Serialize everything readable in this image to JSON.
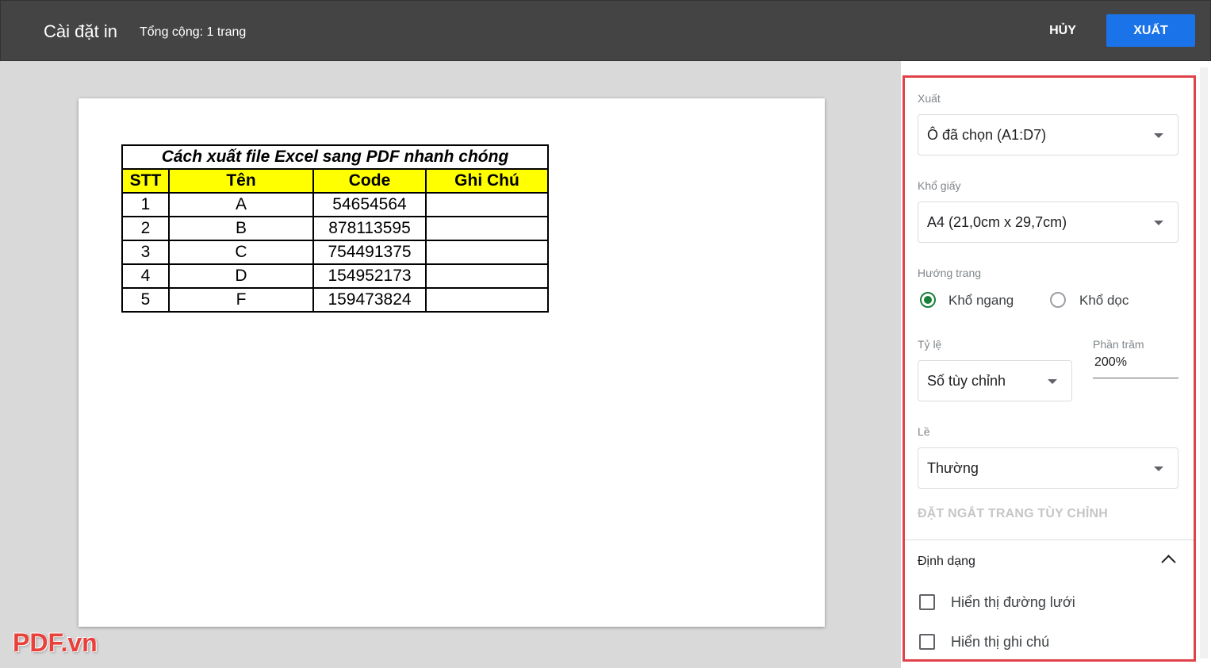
{
  "header": {
    "title": "Cài đặt in",
    "page_count": "Tổng cộng: 1 trang",
    "cancel_label": "HỦY",
    "export_label": "XUẤT"
  },
  "sheet": {
    "title": "Cách xuất file Excel sang PDF nhanh chóng",
    "columns": [
      "STT",
      "Tên",
      "Code",
      "Ghi Chú"
    ],
    "rows": [
      [
        "1",
        "A",
        "54654564",
        ""
      ],
      [
        "2",
        "B",
        "878113595",
        ""
      ],
      [
        "3",
        "C",
        "754491375",
        ""
      ],
      [
        "4",
        "D",
        "154952173",
        ""
      ],
      [
        "5",
        "F",
        "159473824",
        ""
      ]
    ],
    "header_color": "#ffff00"
  },
  "settings": {
    "export": {
      "label": "Xuất",
      "value": "Ô đã chọn (A1:D7)"
    },
    "paper_size": {
      "label": "Khổ giấy",
      "value": "A4 (21,0cm x 29,7cm)"
    },
    "orientation": {
      "label": "Hướng trang",
      "options": [
        "Khổ ngang",
        "Khổ dọc"
      ],
      "selected": "Khổ ngang"
    },
    "scale": {
      "label": "Tỷ lệ",
      "value": "Số tùy chỉnh"
    },
    "percent": {
      "label": "Phần trăm",
      "value": "200%"
    },
    "margins": {
      "label": "Lề",
      "value": "Thường"
    },
    "custom_breaks": "ĐẶT NGẮT TRANG TÙY CHỈNH",
    "format": {
      "title": "Định dạng",
      "show_gridlines": {
        "label": "Hiển thị đường lưới",
        "checked": false
      },
      "show_notes": {
        "label": "Hiển thị ghi chú",
        "checked": false
      }
    }
  },
  "watermark": "PDF.vn",
  "colors": {
    "topbar": "#444444",
    "accent": "#1a73e8",
    "radio_selected": "#188038",
    "highlight_border": "#e0424a"
  }
}
